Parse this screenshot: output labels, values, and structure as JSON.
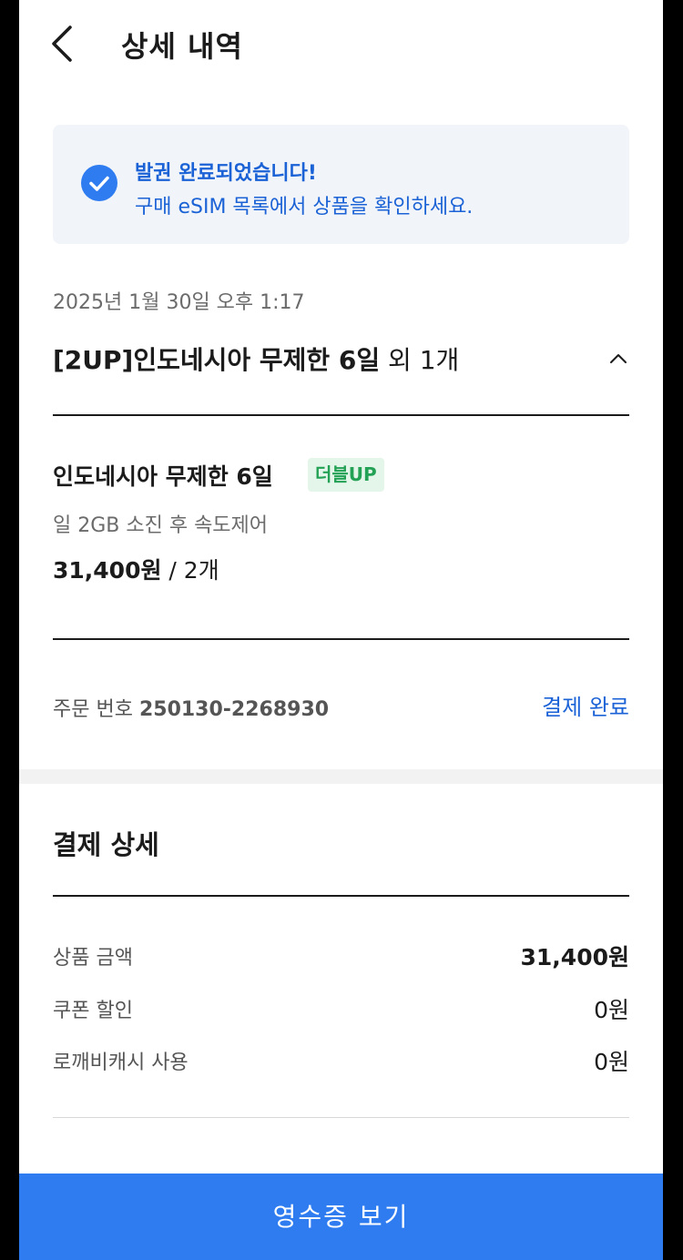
{
  "header": {
    "title": "상세 내역"
  },
  "notice": {
    "title": "발권 완료되었습니다!",
    "subtitle": "구매 eSIM 목록에서 상품을 확인하세요."
  },
  "order": {
    "date": "2025년 1월 30일 오후 1:17",
    "title_main": "[2UP]인도네시아 무제한 6일",
    "title_extra": " 외 1개",
    "number_label": "주문 번호 ",
    "number": "250130-2268930",
    "status": "결제 완료"
  },
  "item": {
    "name": "인도네시아 무제한 6일",
    "badge": "더블UP",
    "desc": "일 2GB 소진 후 속도제어",
    "price": "31,400원",
    "qty": " / 2개"
  },
  "payment": {
    "title": "결제 상세",
    "rows": [
      {
        "label": "상품 금액",
        "value": "31,400원"
      },
      {
        "label": "쿠폰 할인",
        "value": "0원"
      },
      {
        "label": "로깨비캐시 사용",
        "value": "0원"
      }
    ]
  },
  "cta": {
    "label": "영수증 보기"
  },
  "colors": {
    "accent": "#2f7cf1",
    "link": "#1a62d6",
    "badge_bg": "#e4f6ea",
    "badge_text": "#23a155"
  },
  "icons": {
    "back": "chevron-left-icon",
    "check": "check-circle-icon",
    "collapse": "chevron-up-icon"
  }
}
